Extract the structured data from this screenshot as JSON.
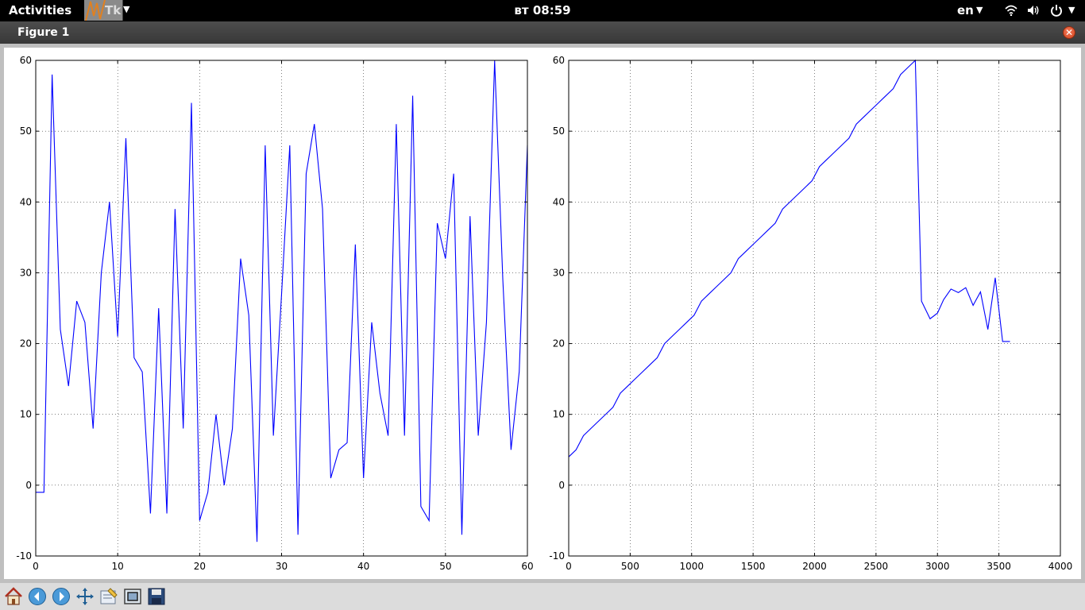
{
  "topbar": {
    "activities": "Activities",
    "app_name": "Tk",
    "clock": "вт 08:59",
    "language": "en",
    "icons": [
      "wifi-icon",
      "volume-icon",
      "power-icon"
    ]
  },
  "window": {
    "title": "Figure 1"
  },
  "toolbar": {
    "buttons": [
      "home-icon",
      "back-icon",
      "forward-icon",
      "pan-icon",
      "configure-subplots-icon",
      "zoom-rect-icon",
      "save-icon"
    ]
  },
  "chart_data": [
    {
      "type": "line",
      "xlim": [
        0,
        60
      ],
      "ylim": [
        -10,
        60
      ],
      "xticks": [
        0,
        10,
        20,
        30,
        40,
        50,
        60
      ],
      "yticks": [
        -10,
        0,
        10,
        20,
        30,
        40,
        50,
        60
      ],
      "grid": true,
      "color": "#0000ff",
      "x": [
        0,
        1,
        2,
        3,
        4,
        5,
        6,
        7,
        8,
        9,
        10,
        11,
        12,
        13,
        14,
        15,
        16,
        17,
        18,
        19,
        20,
        21,
        22,
        23,
        24,
        25,
        26,
        27,
        28,
        29,
        30,
        31,
        32,
        33,
        34,
        35,
        36,
        37,
        38,
        39,
        40,
        41,
        42,
        43,
        44,
        45,
        46,
        47,
        48,
        49,
        50,
        51,
        52,
        53,
        54,
        55,
        56,
        57,
        58,
        59,
        60
      ],
      "y": [
        -1,
        -1,
        58,
        22,
        14,
        26,
        23,
        8,
        30,
        40,
        21,
        49,
        18,
        16,
        -4,
        25,
        -4,
        39,
        8,
        54,
        -5,
        -1,
        10,
        0,
        8,
        32,
        24,
        -8,
        48,
        7,
        27,
        48,
        -7,
        44,
        51,
        39,
        1,
        5,
        6,
        34,
        1,
        23,
        13,
        7,
        51,
        7,
        55,
        -3,
        -5,
        37,
        32,
        44,
        -7,
        38,
        7,
        23,
        60,
        29,
        5,
        16,
        48
      ]
    },
    {
      "type": "line",
      "xlim": [
        0,
        4000
      ],
      "ylim": [
        -10,
        60
      ],
      "xticks": [
        0,
        500,
        1000,
        1500,
        2000,
        2500,
        3000,
        3500,
        4000
      ],
      "yticks": [
        -10,
        0,
        10,
        20,
        30,
        40,
        50,
        60
      ],
      "grid": true,
      "color": "#0000ff",
      "x": [
        0,
        60,
        120,
        180,
        240,
        300,
        360,
        420,
        480,
        540,
        600,
        660,
        720,
        780,
        840,
        900,
        960,
        1020,
        1080,
        1140,
        1200,
        1260,
        1320,
        1380,
        1440,
        1500,
        1560,
        1620,
        1680,
        1740,
        1800,
        1860,
        1920,
        1980,
        2040,
        2100,
        2160,
        2220,
        2280,
        2340,
        2400,
        2460,
        2520,
        2580,
        2640,
        2700,
        2760,
        2820,
        2870,
        2940,
        3000,
        3050,
        3110,
        3170,
        3230,
        3290,
        3350,
        3410,
        3470,
        3530,
        3590
      ],
      "y": [
        4,
        5,
        7,
        8,
        9,
        10,
        11,
        13,
        14,
        15,
        16,
        17,
        18,
        20,
        21,
        22,
        23,
        24,
        26,
        27,
        28,
        29,
        30,
        32,
        33,
        34,
        35,
        36,
        37,
        39,
        40,
        41,
        42,
        43,
        45,
        46,
        47,
        48,
        49,
        51,
        52,
        53,
        54,
        55,
        56,
        58,
        59,
        60,
        26,
        23.5,
        24.3,
        26.2,
        27.7,
        27.2,
        27.9,
        25.4,
        27.3,
        22,
        29.3,
        20.3,
        20.3
      ]
    }
  ]
}
